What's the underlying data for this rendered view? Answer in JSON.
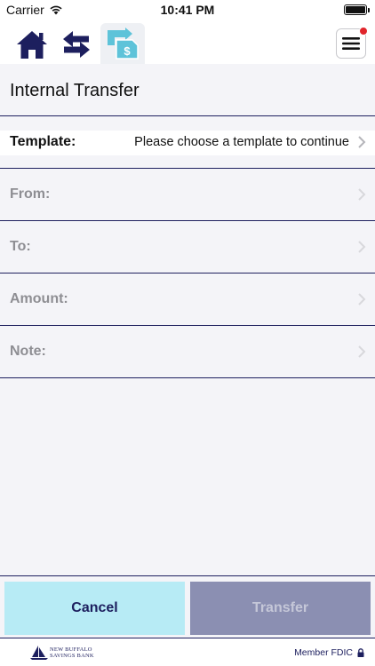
{
  "status_bar": {
    "carrier": "Carrier",
    "time": "10:41 PM",
    "icons": [
      "wifi-icon",
      "battery-icon"
    ]
  },
  "nav": {
    "tabs": [
      {
        "name": "home",
        "icon": "house-icon",
        "active": false
      },
      {
        "name": "transfers",
        "icon": "swap-arrows-icon",
        "active": false
      },
      {
        "name": "internal-transfer",
        "icon": "transfer-dollar-icon",
        "active": true
      }
    ],
    "menu_icon": "hamburger-icon",
    "notification": true
  },
  "page": {
    "title": "Internal Transfer"
  },
  "form": {
    "template": {
      "label": "Template:",
      "value": "Please choose a template to continue",
      "enabled": true
    },
    "from": {
      "label": "From:",
      "value": "",
      "enabled": false
    },
    "to": {
      "label": "To:",
      "value": "",
      "enabled": false
    },
    "amount": {
      "label": "Amount:",
      "value": "",
      "enabled": false
    },
    "note": {
      "label": "Note:",
      "value": "",
      "enabled": false
    }
  },
  "buttons": {
    "cancel_label": "Cancel",
    "transfer_label": "Transfer",
    "transfer_enabled": false
  },
  "footer": {
    "bank_name_line1": "NEW BUFFALO",
    "bank_name_line2": "SAVINGS BANK",
    "fdic_text": "Member FDIC",
    "lock_icon": "lock-icon"
  },
  "colors": {
    "navy": "#1d1f5e",
    "accent_teal": "#5ec3d9",
    "cancel_bg": "#b7ebf5",
    "transfer_bg_disabled": "#8b8fb2",
    "notification": "#e0252b"
  }
}
